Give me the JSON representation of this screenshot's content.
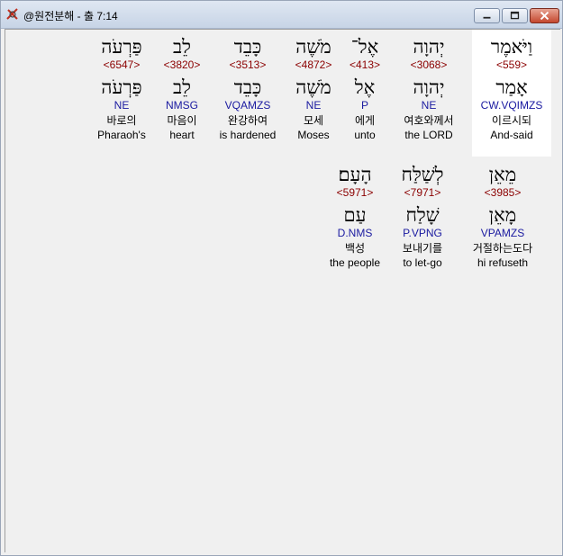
{
  "window": {
    "title": "@원전분해 - 출 7:14"
  },
  "line1": [
    {
      "heb": "וַיֹּאמֶר",
      "num": "<559>",
      "heb2": "אָמַר",
      "parse": "CW.VQIMZS",
      "kor": "이르시되",
      "eng": "And-said"
    },
    {
      "heb": "יְהוָה",
      "num": "<3068>",
      "heb2": "יְהוָה",
      "parse": "NE",
      "kor": "여호와께서",
      "eng": "the LORD"
    },
    {
      "heb": "אֶל־",
      "num": "<413>",
      "heb2": "אֶל",
      "parse": "P",
      "kor": "에게",
      "eng": "unto"
    },
    {
      "heb": "מֹשֶׁה",
      "num": "<4872>",
      "heb2": "מֹשֶׁה",
      "parse": "NE",
      "kor": "모세",
      "eng": "Moses"
    },
    {
      "heb": "כָּבֵד",
      "num": "<3513>",
      "heb2": "כָּבֵד",
      "parse": "VQAMZS",
      "kor": "완강하여",
      "eng": "is hardened"
    },
    {
      "heb": "לֵב",
      "num": "<3820>",
      "heb2": "לֵב",
      "parse": "NMSG",
      "kor": "마음이",
      "eng": "heart"
    },
    {
      "heb": "פַּרְעֹה",
      "num": "<6547>",
      "heb2": "פַּרְעֹה",
      "parse": "NE",
      "kor": "바로의",
      "eng": "Pharaoh's"
    }
  ],
  "line2": [
    {
      "heb": "מֵאֵן",
      "num": "<3985>",
      "heb2": "מָאֵן",
      "parse": "VPAMZS",
      "kor": "거절하는도다",
      "eng": "hi refuseth"
    },
    {
      "heb": "לְשַׁלַּח",
      "num": "<7971>",
      "heb2": "שָׁלַח",
      "parse": "P.VPNG",
      "kor": "보내기를",
      "eng": "to let-go"
    },
    {
      "heb": "הָעָם׃",
      "num": "<5971>",
      "heb2": "עַם",
      "parse": "D.NMS",
      "kor": "백성",
      "eng": "the people"
    }
  ]
}
